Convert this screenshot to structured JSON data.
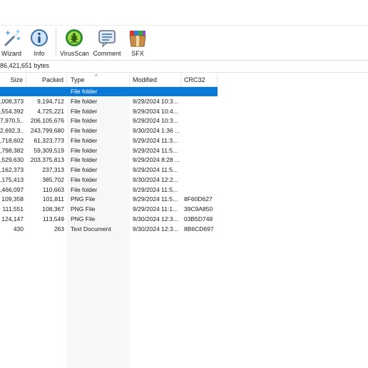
{
  "toolbar": {
    "buttons": [
      {
        "label": "Wizard",
        "icon": "wizard-wand-icon"
      },
      {
        "label": "Info",
        "icon": "info-icon"
      },
      {
        "label": "VirusScan",
        "icon": "virus-scan-icon"
      },
      {
        "label": "Comment",
        "icon": "comment-icon"
      },
      {
        "label": "SFX",
        "icon": "sfx-archive-icon"
      }
    ]
  },
  "status": {
    "size_text": "86,421,651 bytes"
  },
  "table": {
    "columns": [
      "Size",
      "Packed",
      "Type",
      "Modified",
      "CRC32"
    ],
    "rows": [
      {
        "size": "",
        "packed": "",
        "type": "File folder",
        "modified": "",
        "crc": "",
        "selected": true
      },
      {
        "size": ",008,373",
        "packed": "9,194,712",
        "type": "File folder",
        "modified": "9/29/2024 10:3...",
        "crc": ""
      },
      {
        "size": ",554,392",
        "packed": "4,725,221",
        "type": "File folder",
        "modified": "9/29/2024 10:4...",
        "crc": ""
      },
      {
        "size": "7,970,5...",
        "packed": "206,105,676",
        "type": "File folder",
        "modified": "9/29/2024 10:3...",
        "crc": ""
      },
      {
        "size": "2,692,3...",
        "packed": "243,799,680",
        "type": "File folder",
        "modified": "9/30/2024 1:36 ...",
        "crc": ""
      },
      {
        "size": ",718,602",
        "packed": "61,323,773",
        "type": "File folder",
        "modified": "9/29/2024 11:3...",
        "crc": ""
      },
      {
        "size": ",798,382",
        "packed": "59,309,519",
        "type": "File folder",
        "modified": "9/29/2024 11:5...",
        "crc": ""
      },
      {
        "size": ",529,630",
        "packed": "203,375,813",
        "type": "File folder",
        "modified": "9/29/2024 8:28 ...",
        "crc": ""
      },
      {
        "size": ",162,373",
        "packed": "237,313",
        "type": "File folder",
        "modified": "9/29/2024 11:5...",
        "crc": ""
      },
      {
        "size": ",175,413",
        "packed": "385,702",
        "type": "File folder",
        "modified": "9/30/2024 12:2...",
        "crc": ""
      },
      {
        "size": ",466,097",
        "packed": "110,663",
        "type": "File folder",
        "modified": "9/29/2024 11:5...",
        "crc": ""
      },
      {
        "size": "109,358",
        "packed": "101,811",
        "type": "PNG File",
        "modified": "9/29/2024 11:5...",
        "crc": "8F60D627"
      },
      {
        "size": "111,551",
        "packed": "108,367",
        "type": "PNG File",
        "modified": "9/29/2024 11:1...",
        "crc": "39C9A850"
      },
      {
        "size": "124,147",
        "packed": "113,549",
        "type": "PNG File",
        "modified": "9/30/2024 12:3...",
        "crc": "03B5D748"
      },
      {
        "size": "430",
        "packed": "263",
        "type": "Text Document",
        "modified": "9/30/2024 12:3...",
        "crc": "8B6CD697"
      }
    ]
  },
  "colors": {
    "selection": "#0a78d7",
    "sorted_column_bg": "#f7f7f7"
  }
}
